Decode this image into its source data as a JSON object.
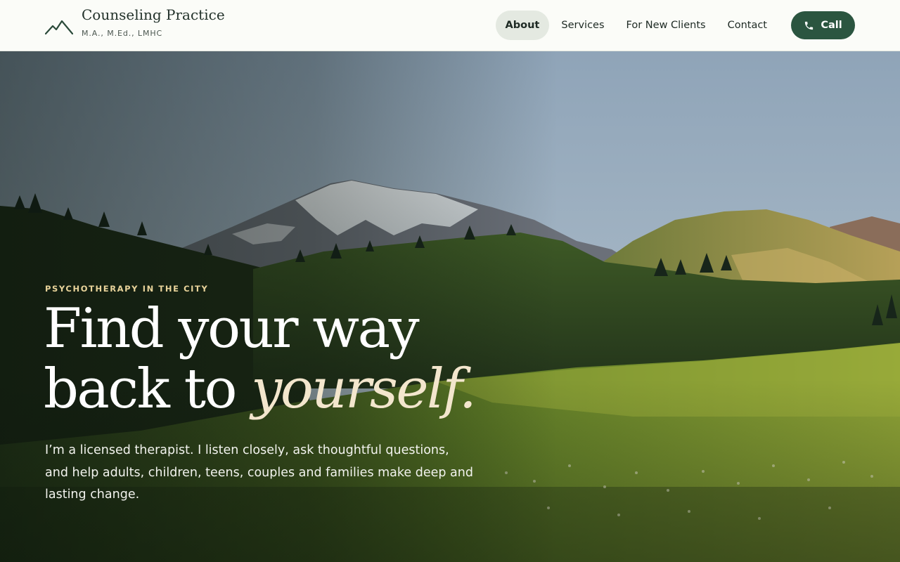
{
  "brand": {
    "title": "Counseling Practice",
    "subtitle": "M.A., M.Ed., LMHC",
    "logo_icon": "mountain-icon"
  },
  "nav": {
    "items": [
      {
        "label": "About",
        "active": true
      },
      {
        "label": "Services",
        "active": false
      },
      {
        "label": "For New Clients",
        "active": false
      },
      {
        "label": "Contact",
        "active": false
      }
    ],
    "call": {
      "label": "Call",
      "icon": "phone-icon"
    }
  },
  "hero": {
    "eyebrow": "PSYCHOTHERAPY IN THE CITY",
    "headline_line1": "Find your way",
    "headline_line2_plain": "back to ",
    "headline_line2_accent": "yourself.",
    "lead": "I’m a licensed therapist. I listen closely, ask thoughtful questions, and help adults, children, teens, couples and families make deep and lasting change."
  },
  "colors": {
    "header_bg": "#fbfcf8",
    "brand_text": "#22312a",
    "nav_active_bg": "#e4e9e1",
    "call_button_bg": "#2b5540",
    "eyebrow": "#e8d39a",
    "accent_text": "#f3e6cd"
  }
}
